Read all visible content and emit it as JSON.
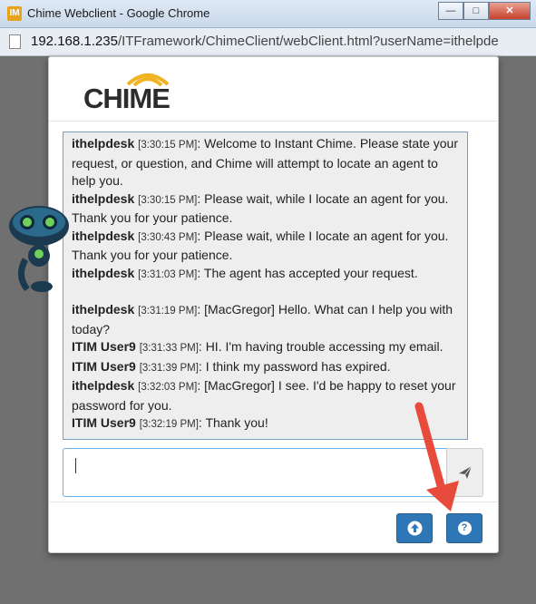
{
  "window": {
    "title": "Chime Webclient - Google Chrome",
    "app_icon": "IM"
  },
  "address": {
    "host": "192.168.1.235",
    "path": "/ITFramework/ChimeClient/webClient.html?userName=ithelpde"
  },
  "logo": {
    "text": "CHIME",
    "accent": "#f0b323"
  },
  "messages": [
    {
      "who": "ithelpdesk",
      "time": "[3:30:15 PM]",
      "text": ": Welcome to Instant Chime. Please state your request, or question, and Chime will attempt to locate an agent to help you."
    },
    {
      "who": "ithelpdesk",
      "time": "[3:30:15 PM]",
      "text": ": Please wait, while I locate an agent for you. Thank you for your patience."
    },
    {
      "who": "ithelpdesk",
      "time": "[3:30:43 PM]",
      "text": ": Please wait, while I locate an agent for you. Thank you for your patience."
    },
    {
      "who": "ithelpdesk",
      "time": "[3:31:03 PM]",
      "text": ": The agent has accepted your request."
    },
    {
      "who": "ithelpdesk",
      "time": "[3:31:19 PM]",
      "text": ": [MacGregor] Hello. What can I help you with today?"
    },
    {
      "who": "ITIM User9",
      "time": "[3:31:33 PM]",
      "text": ": HI. I'm having trouble accessing my email."
    },
    {
      "who": "ITIM User9",
      "time": "[3:31:39 PM]",
      "text": ": I think my password has expired."
    },
    {
      "who": "ithelpdesk",
      "time": "[3:32:03 PM]",
      "text": ": [MacGregor] I see. I'd be happy to reset your password for you."
    },
    {
      "who": "ITIM User9",
      "time": "[3:32:19 PM]",
      "text": ": Thank you!"
    }
  ],
  "input": {
    "value": ""
  },
  "colors": {
    "primary_button": "#2f76b6",
    "annotation_arrow": "#e84b3c",
    "chat_border": "#7a9fc4"
  },
  "icons": {
    "send": "paper-plane-icon",
    "upload": "upload-circle-icon",
    "help": "question-circle-icon",
    "help_glyph": "?"
  }
}
